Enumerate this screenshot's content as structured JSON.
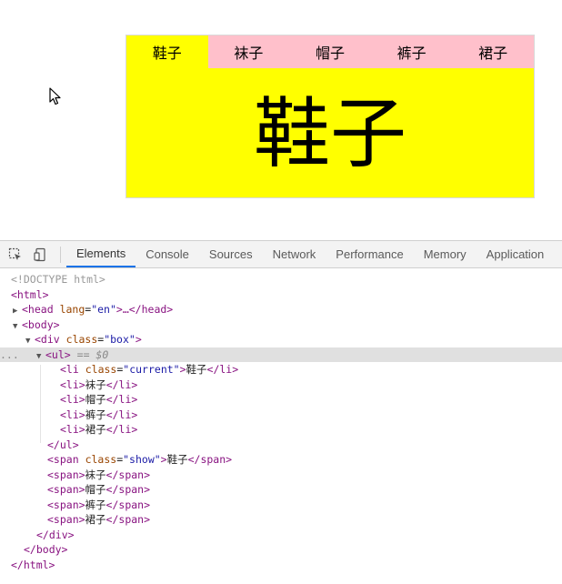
{
  "tabs_widget": {
    "tabs": [
      "鞋子",
      "袜子",
      "帽子",
      "裤子",
      "裙子"
    ],
    "current_index": 0,
    "show_text": "鞋子",
    "colors": {
      "tab_bar": "#ffc0cb",
      "active": "#ffff00",
      "panel": "#ffff00"
    }
  },
  "devtools": {
    "tabs": [
      "Elements",
      "Console",
      "Sources",
      "Network",
      "Performance",
      "Memory",
      "Application"
    ],
    "active_tab": "Elements",
    "dom": {
      "doctype": "<!DOCTYPE html>",
      "html_open": "<html>",
      "head_open": "<head",
      "head_attr": "lang",
      "head_val": "\"en\"",
      "head_close": ">…</head>",
      "body_open": "<body>",
      "div_open": "<div",
      "div_attr": "class",
      "div_val": "\"box\"",
      "ul_open": "<ul>",
      "ul_selected": "== $0",
      "li_open": "<li",
      "li_attr": "class",
      "li_val": "\"current\"",
      "li_text": "鞋子",
      "li_close": "</li>",
      "li_plain_open": "<li>",
      "li_items": [
        "袜子",
        "帽子",
        "裤子",
        "裙子"
      ],
      "ul_close": "</ul>",
      "span_open": "<span",
      "span_attr": "class",
      "span_val": "\"show\"",
      "span_text": "鞋子",
      "span_close": "</span>",
      "span_plain_open": "<span>",
      "span_items": [
        "袜子",
        "帽子",
        "裤子",
        "裙子"
      ],
      "div_close": "</div>",
      "body_close": "</body>",
      "html_close": "</html>",
      "selected_marker": "..."
    }
  }
}
